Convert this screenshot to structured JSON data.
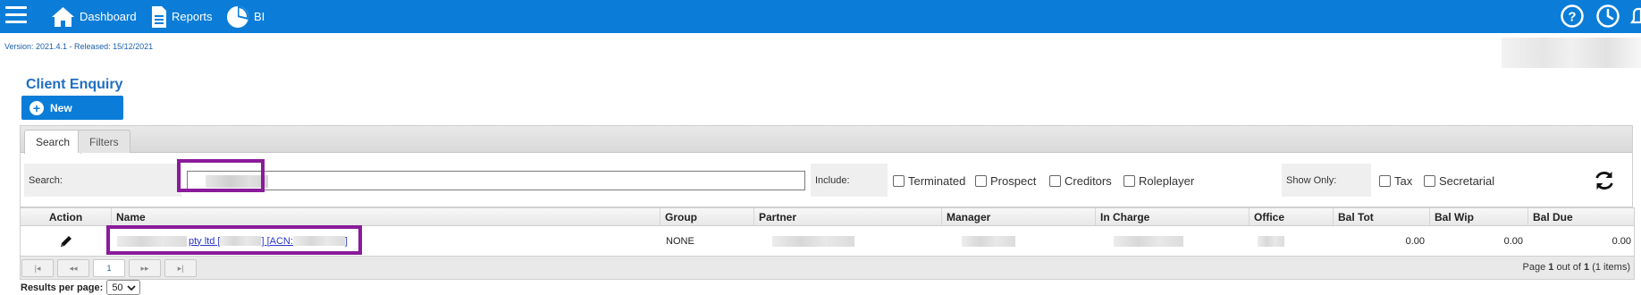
{
  "nav": {
    "dashboard": "Dashboard",
    "reports": "Reports",
    "bi": "BI",
    "icons": [
      "menu-icon",
      "home-icon",
      "document-icon",
      "pie-chart-icon",
      "help-icon",
      "clock-icon",
      "bell-icon"
    ]
  },
  "version": "Version: 2021.4.1 - Released: 15/12/2021",
  "page": {
    "title": "Client Enquiry",
    "new_label": "New"
  },
  "tabs": [
    "Search",
    "Filters"
  ],
  "search": {
    "label": "Search:",
    "value": "",
    "include_label": "Include:",
    "include_options": [
      "Terminated",
      "Prospect",
      "Creditors",
      "Roleplayer"
    ],
    "showonly_label": "Show Only:",
    "showonly_options": [
      "Tax",
      "Secretarial"
    ]
  },
  "table": {
    "headers": [
      "Action",
      "Name",
      "Group",
      "Partner",
      "Manager",
      "In Charge",
      "Office",
      "Bal Tot",
      "Bal Wip",
      "Bal Due"
    ],
    "rows": [
      {
        "name_suffix": "pty ltd [",
        "name_mid": "] [ACN:",
        "name_end": "]",
        "group": "NONE",
        "bal_tot": "0.00",
        "bal_wip": "0.00",
        "bal_due": "0.00"
      }
    ]
  },
  "pager": {
    "first": "|◂",
    "prev": "◂◂",
    "current": "1",
    "next": "▸▸",
    "last": "▸|",
    "info_prefix": "Page ",
    "info_page": "1",
    "info_mid": " out of ",
    "info_total": "1",
    "info_suffix": " (1 items)"
  },
  "results_per_page": {
    "label": "Results per page:",
    "value": "50"
  },
  "colors": {
    "topbar": "#0b7dd8",
    "highlight": "#8a1b9a",
    "link": "#2a35c9"
  }
}
